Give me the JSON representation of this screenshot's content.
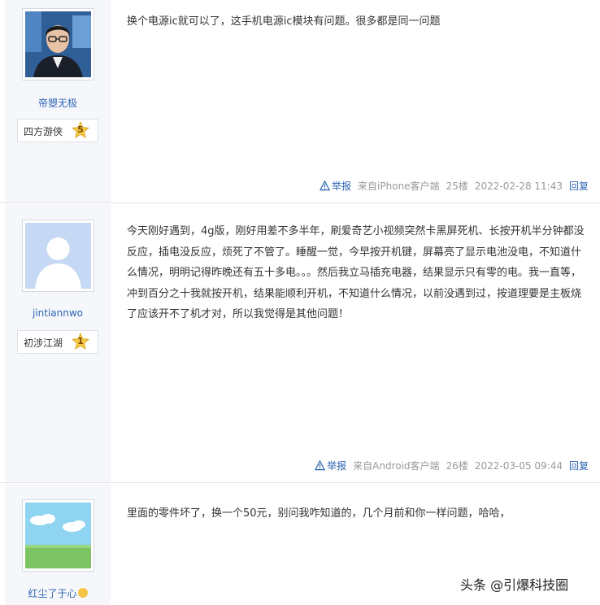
{
  "posts": [
    {
      "username": "帝曌无极",
      "level_name": "四方游侠",
      "level_num": "5",
      "content": "换个电源ic就可以了，这手机电源ic模块有问题。很多都是同一问题",
      "report": "举报",
      "source": "来自iPhone客户端",
      "floor": "25楼",
      "time": "2022-02-28 11:43",
      "reply": "回复"
    },
    {
      "username": "jintiannwo",
      "level_name": "初涉江湖",
      "level_num": "1",
      "content": "今天刚好遇到，4g版，刚好用差不多半年，刷爱奇艺小视频突然卡黑屏死机、长按开机半分钟都没反应，插电没反应，烦死了不管了。睡醒一觉，今早按开机键，屏幕亮了显示电池没电，不知道什么情况，明明记得昨晚还有五十多电。。。然后我立马插充电器，结果显示只有零的电。我一直等，冲到百分之十我就按开机，结果能顺利开机，不知道什么情况，以前没遇到过，按道理要是主板烧了应该开不了机才对，所以我觉得是其他问题！",
      "report": "举报",
      "source": "来自Android客户端",
      "floor": "26楼",
      "time": "2022-03-05 09:44",
      "reply": "回复"
    },
    {
      "username": "红尘了于心",
      "content": "里面的零件坏了，换一个50元，别问我咋知道的，几个月前和你一样问题，哈哈，"
    }
  ],
  "watermark": "头条 @引爆科技圈",
  "colors": {
    "link": "#2d64b3",
    "author_bg": "#f5f7fb",
    "meta": "#999999"
  }
}
